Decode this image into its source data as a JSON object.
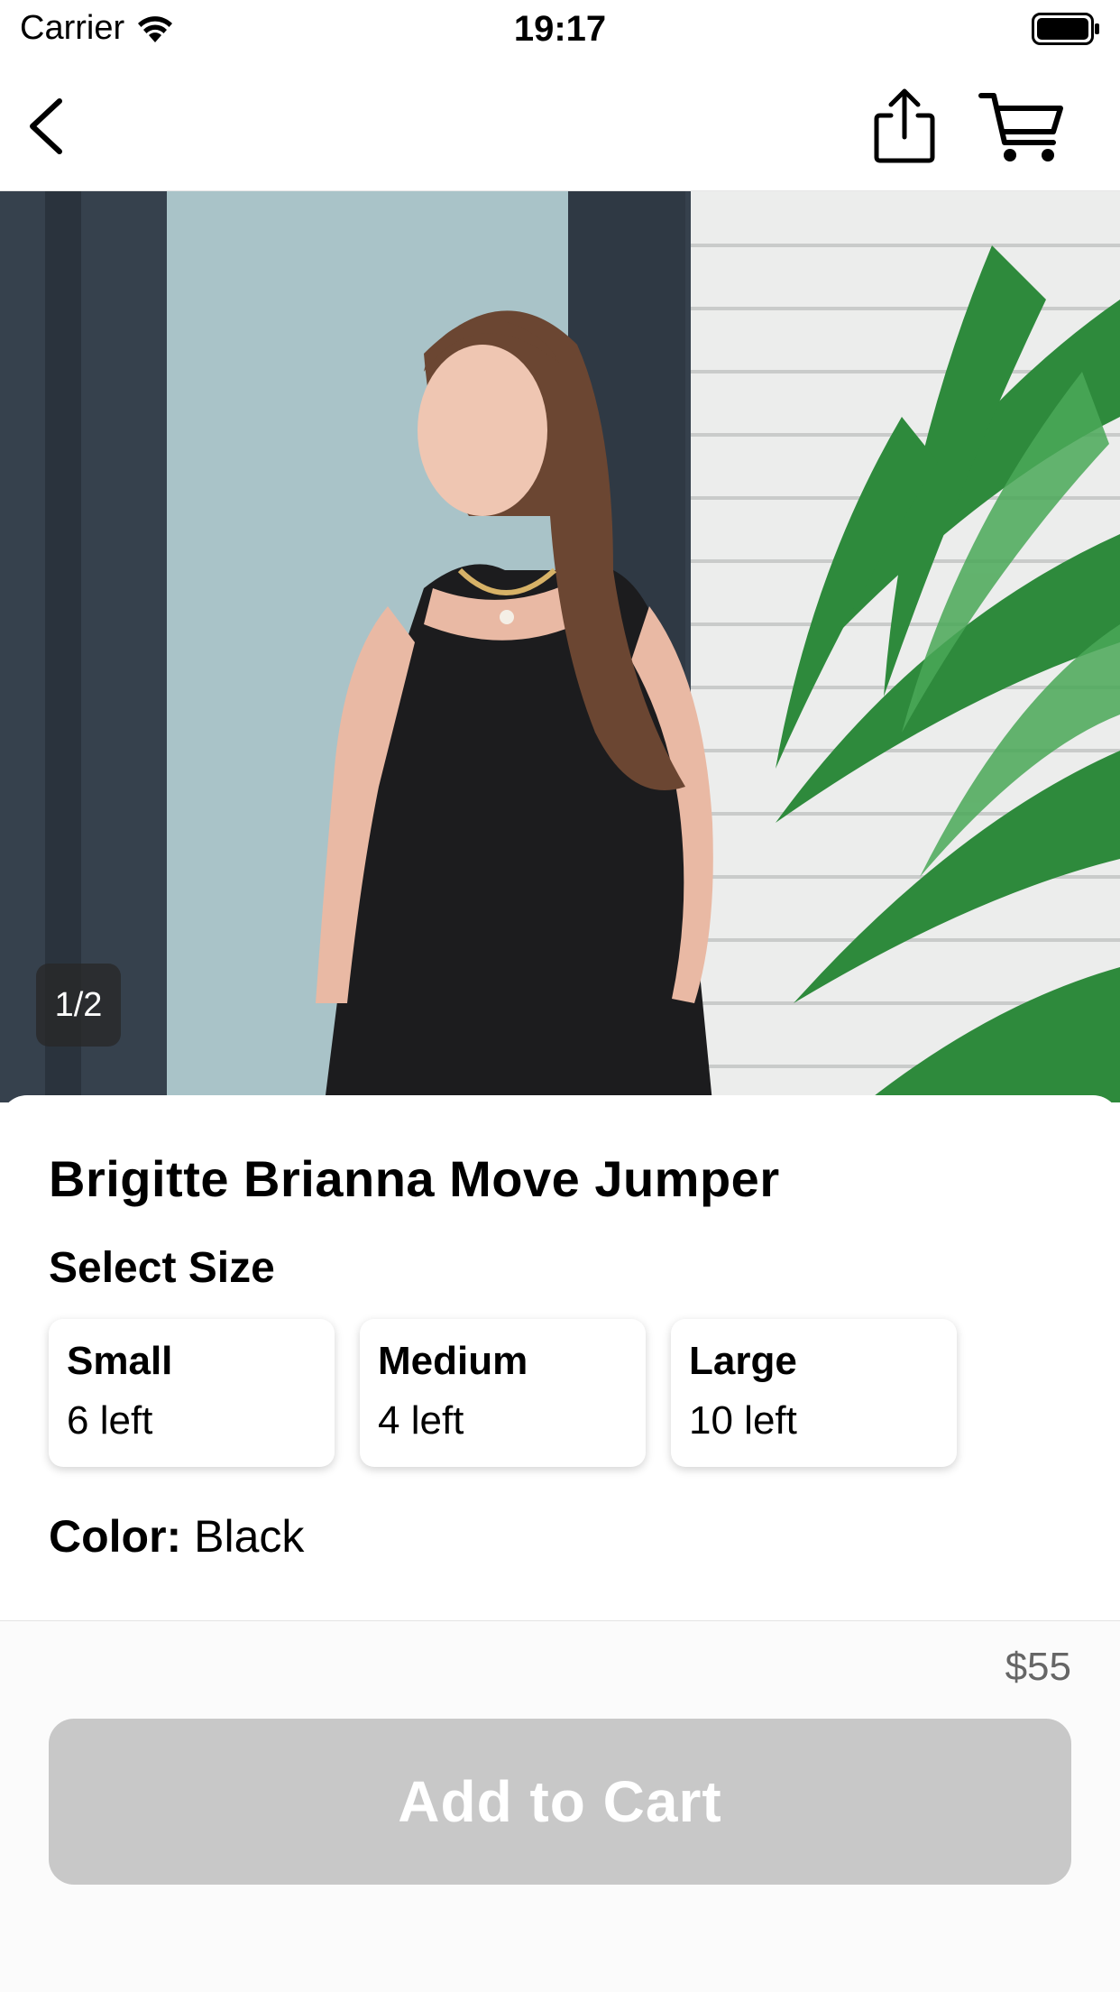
{
  "status_bar": {
    "carrier": "Carrier",
    "time": "19:17"
  },
  "nav": {
    "back_icon": "chevron-left-icon",
    "share_icon": "share-icon",
    "cart_icon": "cart-icon"
  },
  "gallery": {
    "counter": "1/2"
  },
  "product": {
    "title": "Brigitte Brianna Move Jumper",
    "select_size_label": "Select Size",
    "sizes": [
      {
        "name": "Small",
        "stock": "6 left"
      },
      {
        "name": "Medium",
        "stock": "4 left"
      },
      {
        "name": "Large",
        "stock": "10 left"
      }
    ],
    "color_label": "Color:",
    "color_value": "Black"
  },
  "checkout": {
    "price": "$55",
    "add_to_cart_label": "Add to Cart",
    "button_color": "#c8c8c8"
  }
}
